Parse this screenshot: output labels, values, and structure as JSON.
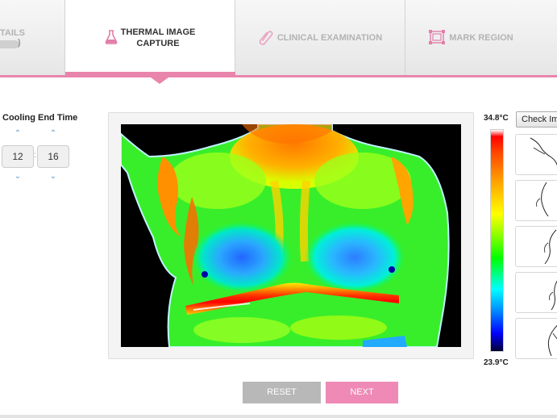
{
  "tabs": [
    {
      "label": "TAILS",
      "sub": ")",
      "icon": "none",
      "active": false
    },
    {
      "label_line1": "THERMAL IMAGE",
      "label_line2": "CAPTURE",
      "icon": "flask-icon",
      "active": true
    },
    {
      "label": "CLINICAL EXAMINATION",
      "icon": "paperclip-icon",
      "active": false
    },
    {
      "label": "MARK REGION",
      "icon": "region-select-icon",
      "active": false
    }
  ],
  "cooling": {
    "title": "Cooling End Time",
    "hours": "12",
    "minutes": "16",
    "separator": ":"
  },
  "scale": {
    "max": "34.8°C",
    "min": "23.9°C"
  },
  "check_button": "Check Im",
  "thumbnails": [
    {
      "view": "right-lateral"
    },
    {
      "view": "right-oblique"
    },
    {
      "view": "front"
    },
    {
      "view": "left-oblique"
    },
    {
      "view": "left-lateral"
    }
  ],
  "buttons": {
    "reset": "RESET",
    "next": "NEXT"
  },
  "colors": {
    "accent": "#e985ad",
    "next_button": "#ee8ab5",
    "reset_button": "#b8b8b8",
    "arrow": "#5e9bc8"
  }
}
